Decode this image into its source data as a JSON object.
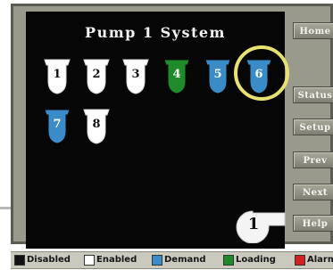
{
  "screen": {
    "title": "Pump 1 System"
  },
  "pumps": [
    {
      "number": "1",
      "state": "enabled"
    },
    {
      "number": "2",
      "state": "enabled"
    },
    {
      "number": "3",
      "state": "enabled"
    },
    {
      "number": "4",
      "state": "loading"
    },
    {
      "number": "5",
      "state": "demand"
    },
    {
      "number": "6",
      "state": "demand",
      "highlighted": true
    },
    {
      "number": "7",
      "state": "demand"
    },
    {
      "number": "8",
      "state": "enabled"
    }
  ],
  "selected_pump_badge": "1",
  "side_buttons": {
    "home": "Home",
    "status": "Status",
    "setup": "Setup",
    "prev": "Prev",
    "next": "Next",
    "help": "Help"
  },
  "legend": [
    {
      "label": "Disabled",
      "color": "#111111"
    },
    {
      "label": "Enabled",
      "color": "#ffffff"
    },
    {
      "label": "Demand",
      "color": "#3a8cc8"
    },
    {
      "label": "Loading",
      "color": "#1f8a2a"
    },
    {
      "label": "Alarm",
      "color": "#d42020"
    }
  ],
  "colors": {
    "screen_background": "#060606",
    "frame": "#9a9a8c",
    "highlight_ring": "#e8e070"
  }
}
